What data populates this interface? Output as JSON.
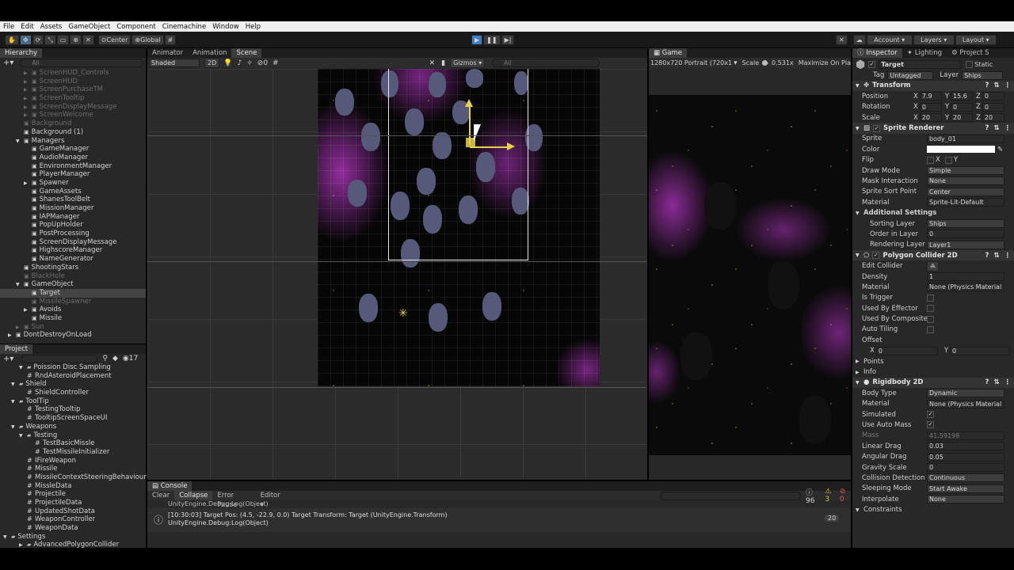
{
  "menu": [
    "File",
    "Edit",
    "Assets",
    "GameObject",
    "Component",
    "Cinemachine",
    "Window",
    "Help"
  ],
  "toolbar": {
    "pivot": "Center",
    "space": "Global",
    "account": "Account",
    "layers": "Layers",
    "layout": "Layout"
  },
  "hierarchy": {
    "tab": "Hierarchy",
    "search": "All",
    "items": [
      {
        "label": "ScreenHUD_Controls",
        "indent": 3,
        "dim": true,
        "arrow": "▶"
      },
      {
        "label": "ScreenHUD",
        "indent": 3,
        "dim": true,
        "arrow": "▶"
      },
      {
        "label": "ScreenPurchaseTM",
        "indent": 3,
        "dim": true,
        "arrow": "▶"
      },
      {
        "label": "ScreenTooltip",
        "indent": 3,
        "dim": true,
        "arrow": "▶"
      },
      {
        "label": "ScreenDisplayMessage",
        "indent": 3,
        "dim": true,
        "arrow": "▶"
      },
      {
        "label": "ScreenWelcome",
        "indent": 3,
        "dim": true,
        "arrow": "▶"
      },
      {
        "label": "Background",
        "indent": 2,
        "dim": true,
        "arrow": ""
      },
      {
        "label": "Background (1)",
        "indent": 2,
        "dim": false,
        "arrow": ""
      },
      {
        "label": "Managers",
        "indent": 2,
        "dim": false,
        "arrow": "▼"
      },
      {
        "label": "GameManager",
        "indent": 3,
        "dim": false,
        "arrow": ""
      },
      {
        "label": "AudioManager",
        "indent": 3,
        "dim": false,
        "arrow": ""
      },
      {
        "label": "EnvironmentManager",
        "indent": 3,
        "dim": false,
        "arrow": ""
      },
      {
        "label": "PlayerManager",
        "indent": 3,
        "dim": false,
        "arrow": ""
      },
      {
        "label": "Spawner",
        "indent": 3,
        "dim": false,
        "arrow": "▶"
      },
      {
        "label": "GameAssets",
        "indent": 3,
        "dim": false,
        "arrow": ""
      },
      {
        "label": "ShanesToolBelt",
        "indent": 3,
        "dim": false,
        "arrow": ""
      },
      {
        "label": "MissionManager",
        "indent": 3,
        "dim": false,
        "arrow": ""
      },
      {
        "label": "IAPManager",
        "indent": 3,
        "dim": false,
        "arrow": ""
      },
      {
        "label": "PopUpHolder",
        "indent": 3,
        "dim": false,
        "arrow": ""
      },
      {
        "label": "PostProcessing",
        "indent": 3,
        "dim": false,
        "arrow": ""
      },
      {
        "label": "ScreenDisplayMessage",
        "indent": 3,
        "dim": false,
        "arrow": ""
      },
      {
        "label": "HighscoreManager",
        "indent": 3,
        "dim": false,
        "arrow": ""
      },
      {
        "label": "NameGenerator",
        "indent": 3,
        "dim": false,
        "arrow": ""
      },
      {
        "label": "ShootingStars",
        "indent": 2,
        "dim": false,
        "arrow": ""
      },
      {
        "label": "BlackHole",
        "indent": 2,
        "dim": true,
        "arrow": ""
      },
      {
        "label": "GameObject",
        "indent": 2,
        "dim": false,
        "arrow": "▼"
      },
      {
        "label": "Target",
        "indent": 3,
        "dim": false,
        "arrow": "",
        "sel": true
      },
      {
        "label": "MissileSpawner",
        "indent": 3,
        "dim": true,
        "arrow": ""
      },
      {
        "label": "Avoids",
        "indent": 3,
        "dim": false,
        "arrow": "▶"
      },
      {
        "label": "Missile",
        "indent": 3,
        "dim": false,
        "arrow": ""
      },
      {
        "label": "Sun",
        "indent": 2,
        "dim": true,
        "arrow": "▶"
      },
      {
        "label": "DontDestroyOnLoad",
        "indent": 1,
        "dim": false,
        "arrow": "▶"
      }
    ]
  },
  "project": {
    "tab": "Project",
    "count": "17",
    "items": [
      {
        "label": "Poission Disc Sampling",
        "indent": 2,
        "arrow": "▼",
        "dim": false
      },
      {
        "label": "RndAsteroidPlacement",
        "indent": 3,
        "arrow": "#",
        "dim": false
      },
      {
        "label": "Shield",
        "indent": 1,
        "arrow": "▼",
        "dim": false
      },
      {
        "label": "ShieldController",
        "indent": 3,
        "arrow": "#",
        "dim": false
      },
      {
        "label": "ToolTip",
        "indent": 1,
        "arrow": "▼",
        "dim": false
      },
      {
        "label": "TestingTooltip",
        "indent": 3,
        "arrow": "#",
        "dim": false
      },
      {
        "label": "TooltipScreenSpaceUI",
        "indent": 3,
        "arrow": "#",
        "dim": false
      },
      {
        "label": "Weapons",
        "indent": 1,
        "arrow": "▼",
        "dim": false
      },
      {
        "label": "Testing",
        "indent": 2,
        "arrow": "▼",
        "dim": false
      },
      {
        "label": "TestBasicMissle",
        "indent": 4,
        "arrow": "#",
        "dim": false
      },
      {
        "label": "TestMissileInitializer",
        "indent": 4,
        "arrow": "#",
        "dim": false
      },
      {
        "label": "IFireWeapon",
        "indent": 3,
        "arrow": "#",
        "dim": false
      },
      {
        "label": "Missile",
        "indent": 3,
        "arrow": "#",
        "dim": false
      },
      {
        "label": "MissileContextSteeringBehaviour",
        "indent": 3,
        "arrow": "#",
        "dim": false
      },
      {
        "label": "MissleData",
        "indent": 3,
        "arrow": "#",
        "dim": false
      },
      {
        "label": "Projectile",
        "indent": 3,
        "arrow": "#",
        "dim": false
      },
      {
        "label": "ProjectileData",
        "indent": 3,
        "arrow": "#",
        "dim": false
      },
      {
        "label": "UpdatedShotData",
        "indent": 3,
        "arrow": "#",
        "dim": false
      },
      {
        "label": "WeaponController",
        "indent": 3,
        "arrow": "#",
        "dim": false
      },
      {
        "label": "WeaponData",
        "indent": 3,
        "arrow": "#",
        "dim": false
      },
      {
        "label": "Settings",
        "indent": 0,
        "arrow": "▼",
        "dim": false
      },
      {
        "label": "AdvancedPolygonCollider",
        "indent": 2,
        "arrow": "▶",
        "dim": false
      }
    ]
  },
  "scene": {
    "tabs": [
      "Animator",
      "Animation",
      "Scene"
    ],
    "shading": "Shaded",
    "mode2d": "2D",
    "gizmos": "Gizmos",
    "search": "All",
    "zero": "0"
  },
  "game": {
    "tab": "Game",
    "resolution": "1280x720 Portrait (720x1",
    "scale_label": "Scale",
    "scale_value": "0.531x",
    "maximize": "Maximize On Pla"
  },
  "console": {
    "tab": "Console",
    "clear": "Clear",
    "collapse": "Collapse",
    "error_pause": "Error Pause",
    "editor": "Editor",
    "count_log": "96",
    "count_warn": "3",
    "count_err": "0",
    "line0": "UnityEngine.Debug:Log(Object)",
    "line1": "[10:30:03] Target Pos: (4.5, -22.9, 0.0) Target Transform: Target (UnityEngine.Transform)",
    "line2": "UnityEngine.Debug:Log(Object)",
    "entry_count": "20"
  },
  "inspector": {
    "tabs": [
      "Inspector",
      "Lighting",
      "Project S"
    ],
    "name": "Target",
    "static": "Static",
    "tag_label": "Tag",
    "tag": "Untagged",
    "layer_label": "Layer",
    "layer": "Ships",
    "transform": {
      "title": "Transform",
      "pos": [
        "Position",
        "7.9",
        "15.6",
        "0"
      ],
      "rot": [
        "Rotation",
        "0",
        "0",
        "0"
      ],
      "scale": [
        "Scale",
        "20",
        "20",
        "20"
      ]
    },
    "sprite_renderer": {
      "title": "Sprite Renderer",
      "sprite": [
        "Sprite",
        "body_01"
      ],
      "color": [
        "Color",
        ""
      ],
      "flip": [
        "Flip",
        "X",
        "Y"
      ],
      "draw_mode": [
        "Draw Mode",
        "Simple"
      ],
      "mask": [
        "Mask Interaction",
        "None"
      ],
      "sort_point": [
        "Sprite Sort Point",
        "Center"
      ],
      "material": [
        "Material",
        "Sprite-Lit-Default"
      ],
      "additional": "Additional Settings",
      "sorting_layer": [
        "Sorting Layer",
        "Ships"
      ],
      "order": [
        "Order in Layer",
        "0"
      ],
      "render_layer": [
        "Rendering Layer M",
        "Layer1"
      ]
    },
    "polygon": {
      "title": "Polygon Collider 2D",
      "edit": "Edit Collider",
      "density": [
        "Density",
        "1"
      ],
      "material": [
        "Material",
        "None (Physics Material"
      ],
      "trigger": "Is Trigger",
      "effector": "Used By Effector",
      "composite": "Used By Composite",
      "tiling": "Auto Tiling",
      "offset": "Offset",
      "ox": [
        "X",
        "0"
      ],
      "oy": [
        "Y",
        "0"
      ],
      "points": "Points",
      "info": "Info"
    },
    "rigidbody": {
      "title": "Rigidbody 2D",
      "body_type": [
        "Body Type",
        "Dynamic"
      ],
      "material": [
        "Material",
        "None (Physics Material"
      ],
      "simulated": "Simulated",
      "auto_mass": "Use Auto Mass",
      "mass": [
        "Mass",
        "41.59198"
      ],
      "linear": [
        "Linear Drag",
        "0.03"
      ],
      "angular": [
        "Angular Drag",
        "0.05"
      ],
      "gravity": [
        "Gravity Scale",
        "0"
      ],
      "collision": [
        "Collision Detection",
        "Continuous"
      ],
      "sleeping": [
        "Sleeping Mode",
        "Start Awake"
      ],
      "interp": [
        "Interpolate",
        "None"
      ],
      "constraints": "Constraints"
    }
  },
  "colors": {
    "accent": "#3d7fc8",
    "panel": "#282828",
    "tabbar": "#1e1e1e",
    "nebula": "#c03ad0"
  }
}
